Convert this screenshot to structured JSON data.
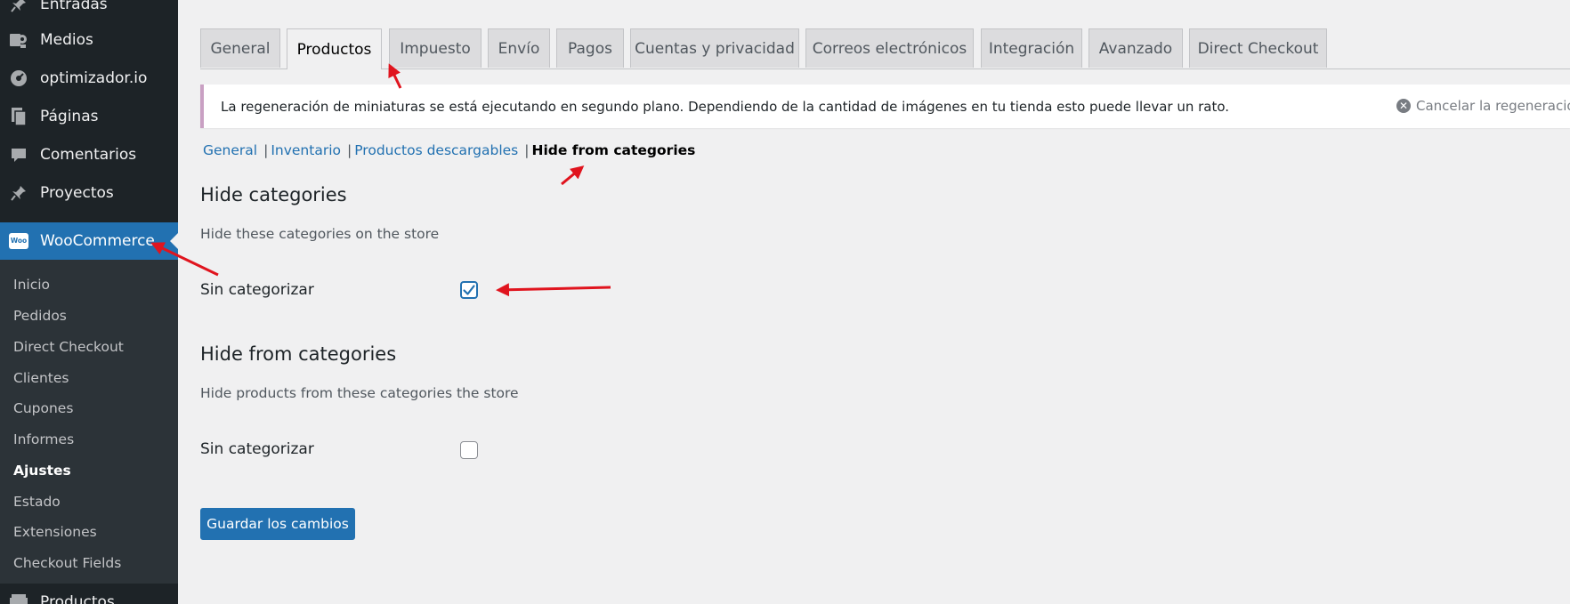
{
  "sidebar": {
    "items": [
      {
        "label": "Entradas",
        "icon": "pin-icon"
      },
      {
        "label": "Medios",
        "icon": "media-icon"
      },
      {
        "label": "optimizador.io",
        "icon": "gauge-icon"
      },
      {
        "label": "Páginas",
        "icon": "pages-icon"
      },
      {
        "label": "Comentarios",
        "icon": "comment-icon"
      },
      {
        "label": "Proyectos",
        "icon": "pin-icon"
      },
      {
        "label": "WooCommerce",
        "icon": "woo-icon",
        "icon_text": "Woo"
      },
      {
        "label": "Productos",
        "icon": "products-icon"
      }
    ],
    "submenu": [
      "Inicio",
      "Pedidos",
      "Direct Checkout",
      "Clientes",
      "Cupones",
      "Informes",
      "Ajustes",
      "Estado",
      "Extensiones",
      "Checkout Fields"
    ],
    "current_submenu": "Ajustes"
  },
  "tabs": [
    {
      "label": "General"
    },
    {
      "label": "Productos",
      "active": true
    },
    {
      "label": "Impuesto"
    },
    {
      "label": "Envío"
    },
    {
      "label": "Pagos"
    },
    {
      "label": "Cuentas y privacidad"
    },
    {
      "label": "Correos electrónicos"
    },
    {
      "label": "Integración"
    },
    {
      "label": "Avanzado"
    },
    {
      "label": "Direct Checkout"
    }
  ],
  "notice": {
    "text": "La regeneración de miniaturas se está ejecutando en segundo plano. Dependiendo de la cantidad de imágenes en tu tienda esto puede llevar un rato.",
    "action": "Cancelar la regeneración de"
  },
  "subsections": {
    "links": [
      "General",
      "Inventario",
      "Productos descargables"
    ],
    "current": "Hide from categories",
    "separator": "|"
  },
  "sections": [
    {
      "title": "Hide categories",
      "description": "Hide these categories on the store",
      "field_label": "Sin categorizar",
      "checked": true
    },
    {
      "title": "Hide from categories",
      "description": "Hide products from these categories the store",
      "field_label": "Sin categorizar",
      "checked": false
    }
  ],
  "save_button": "Guardar los cambios",
  "colors": {
    "sidebar_bg": "#1d2327",
    "submenu_bg": "#2c3338",
    "active_blue": "#2271b1",
    "annotation_red": "#e0141e",
    "notice_border": "#c9a0c3"
  }
}
